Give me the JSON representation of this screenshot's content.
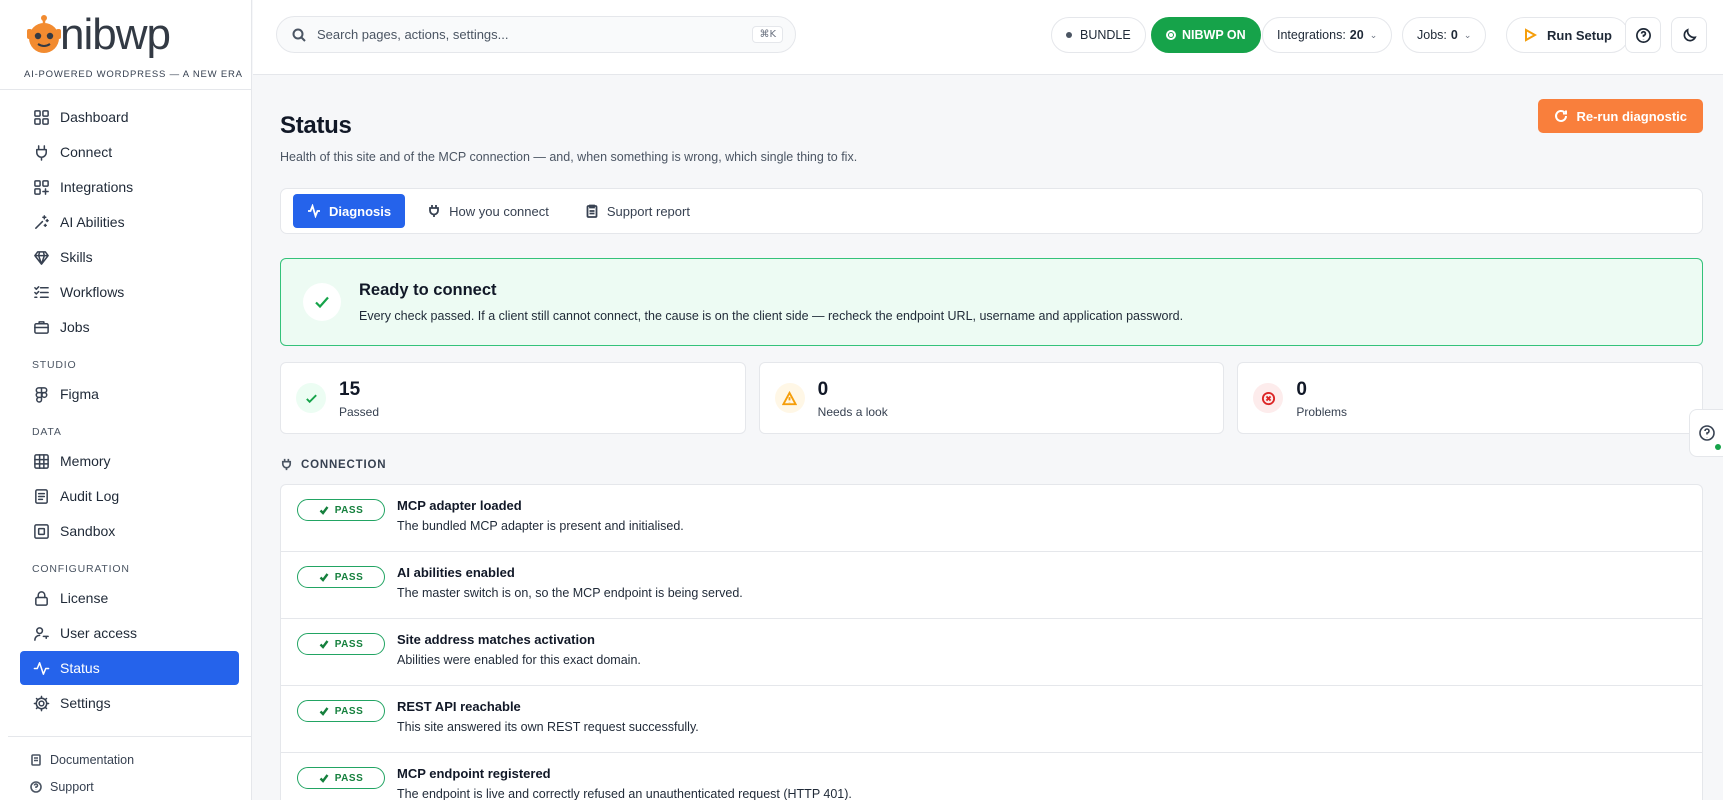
{
  "brand": {
    "name": "nibwp",
    "tagline": "AI-POWERED WORDPRESS — A NEW ERA"
  },
  "sidebar": {
    "items": [
      {
        "label": "Dashboard",
        "icon": "grid-icon"
      },
      {
        "label": "Connect",
        "icon": "plug-icon"
      },
      {
        "label": "Integrations",
        "icon": "grid-plus-icon"
      },
      {
        "label": "AI Abilities",
        "icon": "sparkle-icon"
      },
      {
        "label": "Skills",
        "icon": "gem-icon"
      },
      {
        "label": "Workflows",
        "icon": "list-check-icon"
      },
      {
        "label": "Jobs",
        "icon": "briefcase-icon"
      }
    ],
    "studio_label": "STUDIO",
    "studio_items": [
      {
        "label": "Figma",
        "icon": "figma-icon"
      }
    ],
    "data_label": "DATA",
    "data_items": [
      {
        "label": "Memory",
        "icon": "grid-table-icon"
      },
      {
        "label": "Audit Log",
        "icon": "document-icon"
      },
      {
        "label": "Sandbox",
        "icon": "box-icon"
      }
    ],
    "config_label": "CONFIGURATION",
    "config_items": [
      {
        "label": "License",
        "icon": "lock-icon"
      },
      {
        "label": "User access",
        "icon": "user-key-icon"
      },
      {
        "label": "Status",
        "icon": "activity-icon",
        "active": true
      },
      {
        "label": "Settings",
        "icon": "gear-icon"
      }
    ],
    "footer": [
      {
        "label": "Documentation",
        "icon": "book-icon"
      },
      {
        "label": "Support",
        "icon": "help-circle-icon"
      }
    ]
  },
  "topbar": {
    "search_placeholder": "Search pages, actions, settings...",
    "search_shortcut": "⌘K",
    "bundle_label": "BUNDLE",
    "nibwp_on_label": "NIBWP ON",
    "integrations_label": "Integrations:",
    "integrations_count": "20",
    "jobs_label": "Jobs:",
    "jobs_count": "0",
    "run_setup_label": "Run Setup"
  },
  "page": {
    "title": "Status",
    "subtitle": "Health of this site and of the MCP connection — and, when something is wrong, which single thing to fix.",
    "rerun_label": "Re-run diagnostic",
    "tabs": [
      {
        "label": "Diagnosis",
        "icon": "activity-icon",
        "active": true
      },
      {
        "label": "How you connect",
        "icon": "plug-icon"
      },
      {
        "label": "Support report",
        "icon": "clipboard-icon"
      }
    ],
    "banner": {
      "title": "Ready to connect",
      "text": "Every check passed. If a client still cannot connect, the cause is on the client side — recheck the endpoint URL, username and application password."
    },
    "stats": [
      {
        "value": "15",
        "label": "Passed",
        "color": "#16a34a",
        "bg": "#ecfdf3"
      },
      {
        "value": "0",
        "label": "Needs a look",
        "color": "#f59e0b",
        "bg": "#fff7e6"
      },
      {
        "value": "0",
        "label": "Problems",
        "color": "#dc2626",
        "bg": "#fdecec"
      }
    ],
    "section_title": "CONNECTION",
    "checks": [
      {
        "status": "PASS",
        "title": "MCP adapter loaded",
        "desc": "The bundled MCP adapter is present and initialised."
      },
      {
        "status": "PASS",
        "title": "AI abilities enabled",
        "desc": "The master switch is on, so the MCP endpoint is being served."
      },
      {
        "status": "PASS",
        "title": "Site address matches activation",
        "desc": "Abilities were enabled for this exact domain."
      },
      {
        "status": "PASS",
        "title": "REST API reachable",
        "desc": "This site answered its own REST request successfully."
      },
      {
        "status": "PASS",
        "title": "MCP endpoint registered",
        "desc": "The endpoint is live and correctly refused an unauthenticated request (HTTP 401)."
      }
    ]
  },
  "colors": {
    "accent": "#2563eb",
    "success": "#16a34a",
    "orange": "#f97f3c"
  }
}
